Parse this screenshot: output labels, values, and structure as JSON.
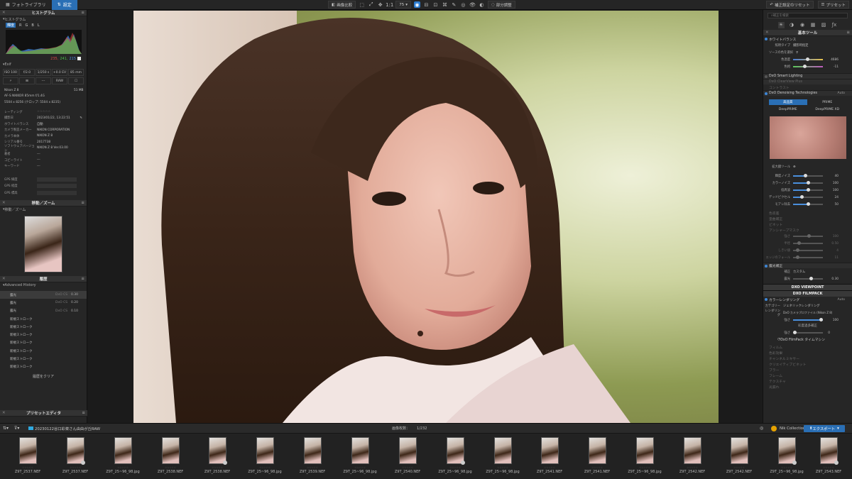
{
  "topbar": {
    "library_tab": "フォトライブラリ",
    "customize_tab": "設定",
    "compare_label": "画像比較",
    "zoom": "75",
    "split_label": "部分調整",
    "reset_label": "補正設定のリセット",
    "preset_label": "プリセット"
  },
  "left": {
    "histogram_title": "ヒストグラム",
    "histogram_sub": "ヒストグラム",
    "hist_tabs": [
      "輝度",
      "R",
      "G",
      "B",
      "L"
    ],
    "rgb": {
      "r": "235,",
      "g": "241,",
      "b": "215"
    },
    "exif_sub": "Exif",
    "exif_row1": [
      "ISO 100",
      "f/2.0",
      "1/250 s",
      "+0.0 EV",
      "85 mm"
    ],
    "exif_row2": [
      "",
      "",
      "---",
      "RAW",
      ""
    ],
    "camera": "Nikon Z 8",
    "size": "51 MB",
    "lens": "AF-S NIKKOR 85mm f/1.4G",
    "dims": "5504 x 8256 (クロップ: 5504 x 8235)",
    "meta": [
      {
        "k": "レーティング",
        "v": "☆☆☆☆☆"
      },
      {
        "k": "撮影日",
        "v": "2023/01/22, 13:22:51"
      },
      {
        "k": "ホワイトバランス",
        "v": "自動"
      },
      {
        "k": "カメラ製造メーカー",
        "v": "NIKON CORPORATION"
      },
      {
        "k": "カメラ本体",
        "v": "NIKON Z 8"
      },
      {
        "k": "シリアル番号",
        "v": "2017738"
      },
      {
        "k": "ソフトウェアバージョン",
        "v": "NIKON Z 8 Ver.03.00"
      },
      {
        "k": "著者",
        "v": "---"
      },
      {
        "k": "コピーライト",
        "v": "---"
      },
      {
        "k": "キーワード",
        "v": "---"
      }
    ],
    "gps": [
      "GPS 緯度",
      "GPS 経度",
      "GPS 標高"
    ],
    "move_title": "移動／ズーム",
    "move_sub": "移動／ズーム",
    "history_title": "履歴",
    "history_sub": "Advanced History",
    "history": [
      {
        "t": "露光",
        "l": "DxO CS",
        "v": "0.30"
      },
      {
        "t": "露光",
        "l": "DxO CS",
        "v": "0.20"
      },
      {
        "t": "露光",
        "l": "DxO CS",
        "v": "0.10"
      },
      {
        "t": "新規ストローク",
        "l": "",
        "v": ""
      },
      {
        "t": "新規ストローク",
        "l": "",
        "v": ""
      },
      {
        "t": "新規ストローク",
        "l": "",
        "v": ""
      },
      {
        "t": "新規ストローク",
        "l": "",
        "v": ""
      },
      {
        "t": "新規ストローク",
        "l": "",
        "v": ""
      },
      {
        "t": "新規ストローク",
        "l": "",
        "v": ""
      },
      {
        "t": "新規ストローク",
        "l": "",
        "v": ""
      }
    ],
    "clear_label": "履歴をクリア",
    "preset_editor": "プリセットエディタ"
  },
  "right": {
    "search_placeholder": "補正を検索",
    "basic_title": "基本ツール",
    "wb": "ホワイトバランス",
    "wb_type_k": "照明タイプ",
    "wb_type_v": "撮影時指定",
    "picker": "ソースの色を選択",
    "temp": {
      "n": "色温度",
      "v": "4686"
    },
    "tint": {
      "n": "色相",
      "v": "-11"
    },
    "smart_lighting": "DxO Smart Lighting",
    "clearview": "DxO ClearView Plus",
    "contrast": "コントラスト",
    "denoise": "DxO Denoising Technologies",
    "auto": "Auto",
    "dp_tabs": [
      "高品質",
      "PRIME"
    ],
    "deep": [
      "DeepPRIME",
      "DeepPRIME XD"
    ],
    "loupe": "拡大鏡ツール",
    "nr": [
      {
        "n": "輝度ノイズ",
        "v": "40"
      },
      {
        "n": "カラーノイズ",
        "v": "100"
      },
      {
        "n": "低周波",
        "v": "100"
      },
      {
        "n": "デッドピクセル",
        "v": "24"
      },
      {
        "n": "モアレ除去",
        "v": "50"
      }
    ],
    "grey": [
      "色収差",
      "歪曲補正",
      "ビネット",
      "アンシャープマスク"
    ],
    "usm": [
      {
        "n": "強さ",
        "v": "100"
      },
      {
        "n": "半径",
        "v": "0.50"
      },
      {
        "n": "しきい値",
        "v": "4"
      },
      {
        "n": "エッジのフォール",
        "v": "11"
      }
    ],
    "exp_title": "露光補正",
    "exp_mode_k": "補正",
    "exp_mode_v": "カスタム",
    "exp_val": {
      "n": "露光",
      "v": "0.30"
    },
    "viewpoint": "DXO VIEWPOINT",
    "filmpack": "DXO FILMPACK",
    "color_rendering": "カラーレンダリング",
    "cat_k": "カテゴリー",
    "cat_v": "ジェネリックレンダリング",
    "render_k": "レンダリング",
    "render_v": "DxO カメラプロファイル (Nikon Z 8)",
    "strength": {
      "n": "強さ",
      "v": "100"
    },
    "protect": "彩度過多補正",
    "protect_v": "0",
    "timemachine": "DxO FilmPack タイムマシン",
    "bottom_list": [
      "フィルム",
      "色彩効果",
      "チャンネルミキサー",
      "クリエイティブビネット",
      "ブラー",
      "フレーム",
      "テクスチャ",
      "光漏れ"
    ]
  },
  "bottom": {
    "folder": "20230122谷口彩菜さん由由が丘RAW",
    "count_label": "画像枚数：",
    "count": "1/232",
    "nik": "Nik Collection",
    "export": "エクスポート",
    "files": [
      "Z9T_2537.NEF",
      "Z9T_2537.NEF",
      "Z9T_25~96_98.jpg",
      "Z9T_2538.NEF",
      "Z9T_2538.NEF",
      "Z9T_25~96_98.jpg",
      "Z9T_2539.NEF",
      "Z9T_25~96_98.jpg",
      "Z9T_2540.NEF",
      "Z9T_25~96_98.jpg",
      "Z9T_25~96_98.jpg",
      "Z9T_2541.NEF",
      "Z9T_2541.NEF",
      "Z9T_25~96_98.jpg",
      "Z9T_2542.NEF",
      "Z9T_2542.NEF",
      "Z9T_25~96_98.jpg",
      "Z9T_2543.NEF"
    ],
    "stars": "☆☆☆☆☆"
  }
}
